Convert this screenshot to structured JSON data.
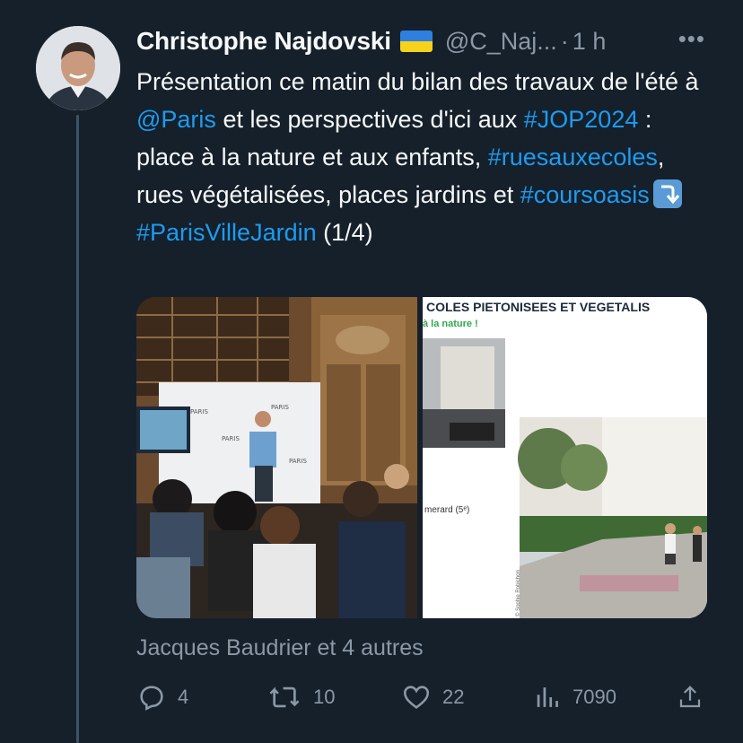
{
  "tweet": {
    "author_name": "Christophe Najdovski",
    "handle": "@C_Naj...",
    "separator": "·",
    "time": "1 h",
    "more_label": "•••",
    "text": {
      "p1": "Présentation ce matin du bilan des travaux de l'été à ",
      "mention": "@Paris",
      "p2": " et les perspectives d'ici aux ",
      "tag1": "#JOP2024",
      "p3": " : place à la nature et aux enfants, ",
      "tag2": "#ruesauxecoles",
      "p4": ", rues végétalisées, places jardins et ",
      "tag3": "#coursoasis",
      "tag4": "#ParisVilleJardin",
      "p5": " (1/4)"
    }
  },
  "media": {
    "photo1": {
      "backdrop_label": "PARIS"
    },
    "photo2": {
      "title": "COLES PIETONISEES ET VEGETALIS",
      "subtitle": "à la nature !",
      "caption": "merard (5ᵉ)",
      "credit": "© Sophie Robichon"
    }
  },
  "liked_by": "Jacques Baudrier et 4 autres",
  "actions": {
    "replies": "4",
    "retweets": "10",
    "likes": "22",
    "views": "7090"
  },
  "colors": {
    "background": "#15202b",
    "link": "#1d9bf0",
    "muted": "#8b98a5",
    "text": "#f7f9f9"
  },
  "icons": [
    "verified-flag-icon",
    "more-icon",
    "reply-icon",
    "retweet-icon",
    "like-icon",
    "views-icon",
    "share-icon",
    "arrow-emoji-icon"
  ]
}
